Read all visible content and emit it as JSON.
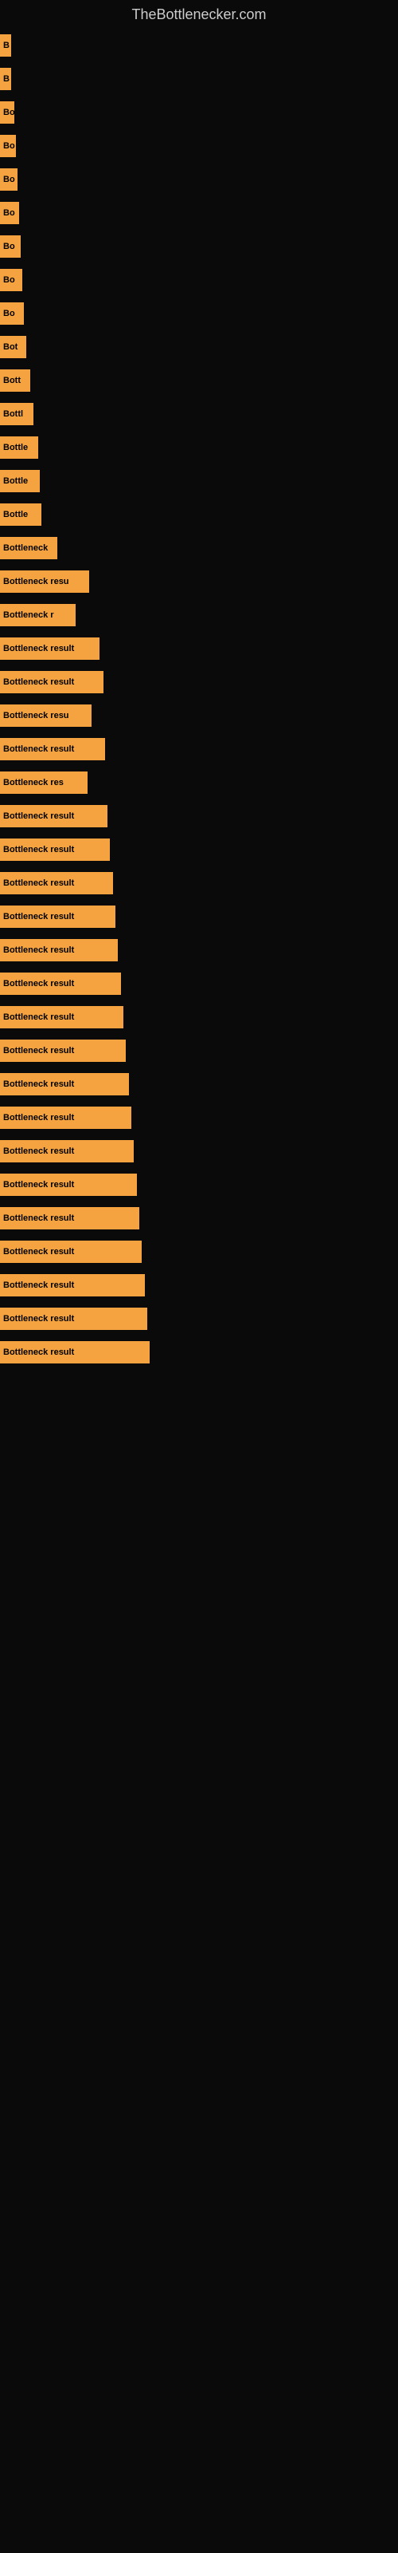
{
  "site": {
    "title": "TheBottlenecker.com"
  },
  "bars": [
    {
      "id": 1,
      "label": "B",
      "width": 14
    },
    {
      "id": 2,
      "label": "B",
      "width": 14
    },
    {
      "id": 3,
      "label": "Bo",
      "width": 18
    },
    {
      "id": 4,
      "label": "Bo",
      "width": 20
    },
    {
      "id": 5,
      "label": "Bo",
      "width": 22
    },
    {
      "id": 6,
      "label": "Bo",
      "width": 24
    },
    {
      "id": 7,
      "label": "Bo",
      "width": 26
    },
    {
      "id": 8,
      "label": "Bo",
      "width": 28
    },
    {
      "id": 9,
      "label": "Bo",
      "width": 30
    },
    {
      "id": 10,
      "label": "Bot",
      "width": 33
    },
    {
      "id": 11,
      "label": "Bott",
      "width": 38
    },
    {
      "id": 12,
      "label": "Bottl",
      "width": 42
    },
    {
      "id": 13,
      "label": "Bottle",
      "width": 48
    },
    {
      "id": 14,
      "label": "Bottle",
      "width": 50
    },
    {
      "id": 15,
      "label": "Bottle",
      "width": 52
    },
    {
      "id": 16,
      "label": "Bottleneck",
      "width": 72
    },
    {
      "id": 17,
      "label": "Bottleneck resu",
      "width": 112
    },
    {
      "id": 18,
      "label": "Bottleneck r",
      "width": 95
    },
    {
      "id": 19,
      "label": "Bottleneck result",
      "width": 125
    },
    {
      "id": 20,
      "label": "Bottleneck result",
      "width": 130
    },
    {
      "id": 21,
      "label": "Bottleneck resu",
      "width": 115
    },
    {
      "id": 22,
      "label": "Bottleneck result",
      "width": 132
    },
    {
      "id": 23,
      "label": "Bottleneck res",
      "width": 110
    },
    {
      "id": 24,
      "label": "Bottleneck result",
      "width": 135
    },
    {
      "id": 25,
      "label": "Bottleneck result",
      "width": 138
    },
    {
      "id": 26,
      "label": "Bottleneck result",
      "width": 142
    },
    {
      "id": 27,
      "label": "Bottleneck result",
      "width": 145
    },
    {
      "id": 28,
      "label": "Bottleneck result",
      "width": 148
    },
    {
      "id": 29,
      "label": "Bottleneck result",
      "width": 152
    },
    {
      "id": 30,
      "label": "Bottleneck result",
      "width": 155
    },
    {
      "id": 31,
      "label": "Bottleneck result",
      "width": 158
    },
    {
      "id": 32,
      "label": "Bottleneck result",
      "width": 162
    },
    {
      "id": 33,
      "label": "Bottleneck result",
      "width": 165
    },
    {
      "id": 34,
      "label": "Bottleneck result",
      "width": 168
    },
    {
      "id": 35,
      "label": "Bottleneck result",
      "width": 172
    },
    {
      "id": 36,
      "label": "Bottleneck result",
      "width": 175
    },
    {
      "id": 37,
      "label": "Bottleneck result",
      "width": 178
    },
    {
      "id": 38,
      "label": "Bottleneck result",
      "width": 182
    },
    {
      "id": 39,
      "label": "Bottleneck result",
      "width": 185
    },
    {
      "id": 40,
      "label": "Bottleneck result",
      "width": 188
    }
  ],
  "colors": {
    "bar": "#f5a340",
    "background": "#0a0a0a",
    "title": "#cccccc"
  }
}
